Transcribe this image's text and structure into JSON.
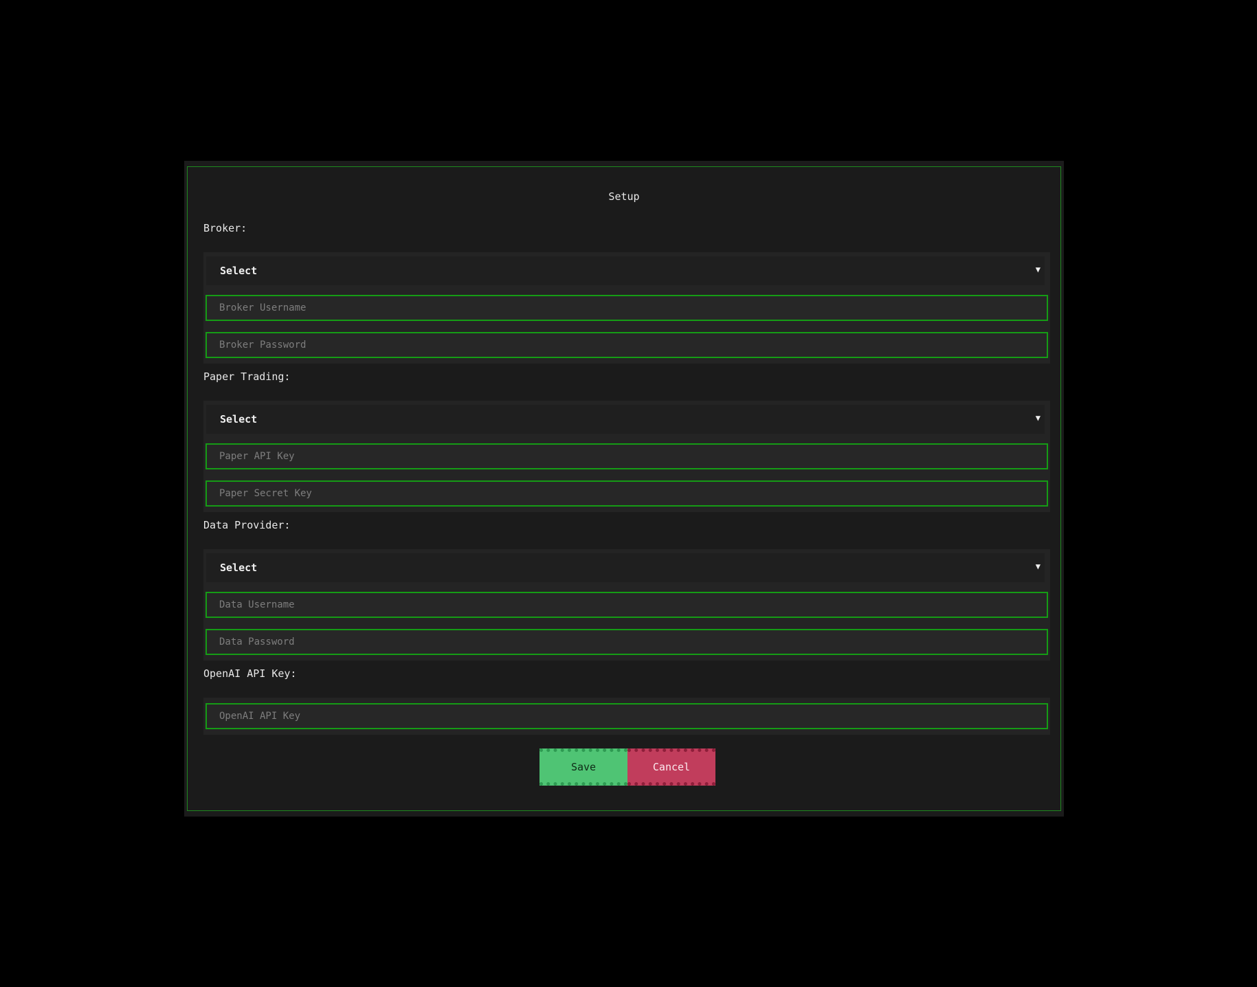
{
  "dialog": {
    "title": "Setup"
  },
  "broker": {
    "label": "Broker:",
    "select_value": "Select",
    "username_placeholder": "Broker Username",
    "password_placeholder": "Broker Password"
  },
  "paper_trading": {
    "label": "Paper Trading:",
    "select_value": "Select",
    "api_key_placeholder": "Paper API Key",
    "secret_key_placeholder": "Paper Secret Key"
  },
  "data_provider": {
    "label": "Data Provider:",
    "select_value": "Select",
    "username_placeholder": "Data Username",
    "password_placeholder": "Data Password"
  },
  "openai": {
    "label": "OpenAI API Key:",
    "api_key_placeholder": "OpenAI API Key"
  },
  "actions": {
    "save_label": "Save",
    "cancel_label": "Cancel"
  },
  "icons": {
    "dropdown": "chevron-down-icon"
  },
  "colors": {
    "accent_green": "#159c15",
    "save_green": "#4fc474",
    "cancel_red": "#c13d5c",
    "background": "#1b1b1b"
  }
}
